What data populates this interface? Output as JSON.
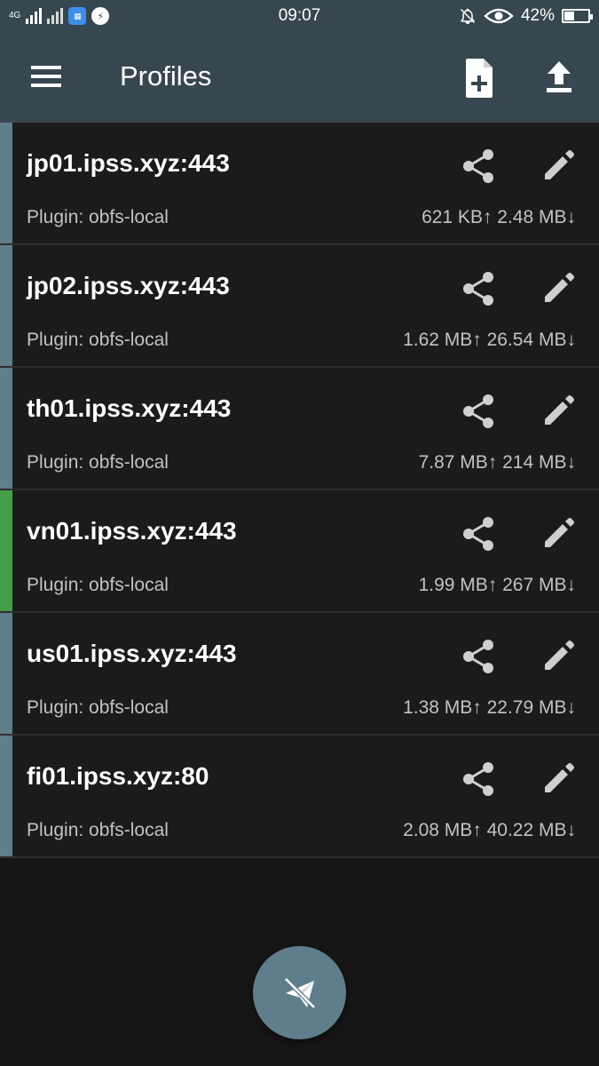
{
  "status_bar": {
    "network": "4G",
    "time": "09:07",
    "battery": "42%",
    "battery_level": 0.42,
    "icons": [
      "signal-icon",
      "no-signal-icon",
      "app-notification-icon",
      "messenger-icon",
      "mute-bell-icon",
      "eye-icon",
      "battery-icon"
    ]
  },
  "app_bar": {
    "title": "Profiles",
    "icons": [
      "menu-icon",
      "new-profile-icon",
      "import-upload-icon"
    ]
  },
  "colors": {
    "toolbar": "#37474f",
    "accent_inactive": "#607d8b",
    "accent_active": "#43a047"
  },
  "profiles": [
    {
      "name": "jp01.ipss.xyz:443",
      "plugin": "Plugin: obfs-local",
      "traffic": "621 KB↑ 2.48 MB↓",
      "active": false
    },
    {
      "name": "jp02.ipss.xyz:443",
      "plugin": "Plugin: obfs-local",
      "traffic": "1.62 MB↑ 26.54 MB↓",
      "active": false
    },
    {
      "name": "th01.ipss.xyz:443",
      "plugin": "Plugin: obfs-local",
      "traffic": "7.87 MB↑ 214 MB↓",
      "active": false
    },
    {
      "name": "vn01.ipss.xyz:443",
      "plugin": "Plugin: obfs-local",
      "traffic": "1.99 MB↑ 267 MB↓",
      "active": true
    },
    {
      "name": "us01.ipss.xyz:443",
      "plugin": "Plugin: obfs-local",
      "traffic": "1.38 MB↑ 22.79 MB↓",
      "active": false
    },
    {
      "name": "fi01.ipss.xyz:80",
      "plugin": "Plugin: obfs-local",
      "traffic": "2.08 MB↑ 40.22 MB↓",
      "active": false
    }
  ],
  "fab": {
    "icon": "paper-plane-off-icon"
  }
}
